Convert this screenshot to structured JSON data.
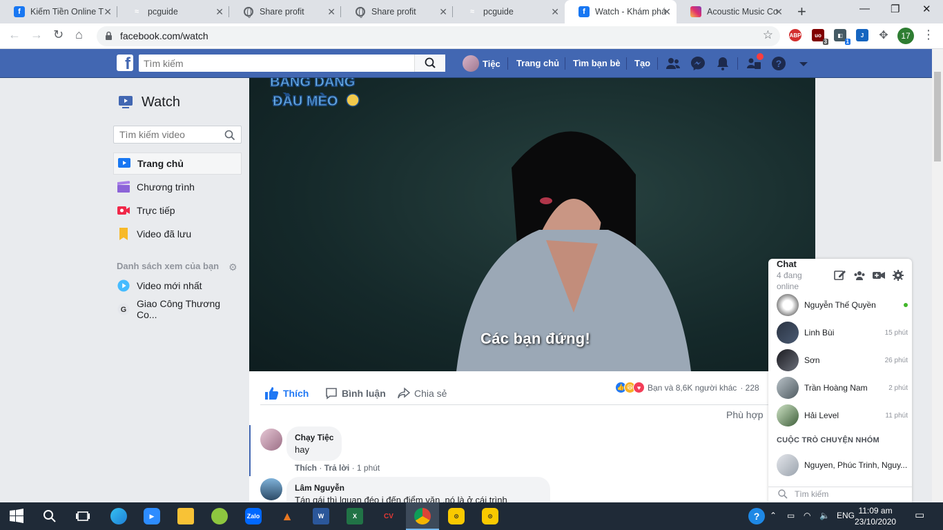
{
  "browser": {
    "tabs": [
      {
        "title": "Kiếm Tiền Online T",
        "icon": "facebook-icon"
      },
      {
        "title": "pcguide",
        "icon": "pcguide-icon"
      },
      {
        "title": "Share profit",
        "icon": "globe-icon"
      },
      {
        "title": "Share profit",
        "icon": "globe-icon"
      },
      {
        "title": "pcguide",
        "icon": "pcguide-icon"
      },
      {
        "title": "Watch - Khám phá",
        "icon": "facebook-icon",
        "active": true
      },
      {
        "title": "Acoustic Music Co",
        "icon": "instagram-icon"
      }
    ],
    "url": "facebook.com/watch",
    "profile_badge": "17",
    "ext_badges": {
      "ublock": "3",
      "ext2": "1"
    }
  },
  "fb_header": {
    "search_placeholder": "Tìm kiếm",
    "user_name": "Tiệc",
    "links": {
      "home": "Trang chủ",
      "friends": "Tìm bạn bè",
      "create": "Tạo"
    }
  },
  "sidebar": {
    "title": "Watch",
    "search_placeholder": "Tìm kiếm video",
    "items": [
      {
        "label": "Trang chủ",
        "icon": "play-square-icon",
        "color": "#1877f2"
      },
      {
        "label": "Chương trình",
        "icon": "clapperboard-icon",
        "color": "#8c64d8"
      },
      {
        "label": "Trực tiếp",
        "icon": "live-camera-icon",
        "color": "#f02849"
      },
      {
        "label": "Video đã lưu",
        "icon": "bookmark-icon",
        "color": "#f7b928"
      }
    ],
    "section_header": "Danh sách xem của bạn",
    "watchlist": [
      {
        "label": "Video mới nhất",
        "icon": "play-circle-icon"
      },
      {
        "label": "Giao Công Thương Co..."
      }
    ]
  },
  "video": {
    "subtitle": "Các bạn đứng!",
    "watermark": "BANG DANG ĐẦU MÈO"
  },
  "feedback": {
    "like": "Thích",
    "comment": "Bình luận",
    "share": "Chia sẻ",
    "reactions_text": "Bạn và 8,6K người khác",
    "reactions_extra": "· 228",
    "sort": "Phù hợp"
  },
  "comments": [
    {
      "author": "Chạy Tiệc",
      "text": "hay",
      "like": "Thích",
      "reply": "Trả lời",
      "time": "· 1 phút"
    },
    {
      "author": "Lâm Nguyễn",
      "text": "Tán gái thì lquan đéo j đến điểm văn ,nó là ở cái trình"
    }
  ],
  "chat": {
    "title": "Chat",
    "subtitle": "4 đang online",
    "contacts": [
      {
        "name": "Nguyễn Thế Quyền",
        "time": "",
        "online": true
      },
      {
        "name": "Linh Bùi",
        "time": "15 phút"
      },
      {
        "name": "Sơn",
        "time": "26 phút"
      },
      {
        "name": "Trần Hoàng Nam",
        "time": "2 phút"
      },
      {
        "name": "Hải Level",
        "time": "11 phút"
      }
    ],
    "group_header": "CUỘC TRÒ CHUYỆN NHÓM",
    "group": "Nguyen, Phúc Trinh, Nguy...",
    "search": "Tìm kiếm"
  },
  "taskbar": {
    "lang": "ENG",
    "time": "11:09 am",
    "date": "23/10/2020"
  }
}
